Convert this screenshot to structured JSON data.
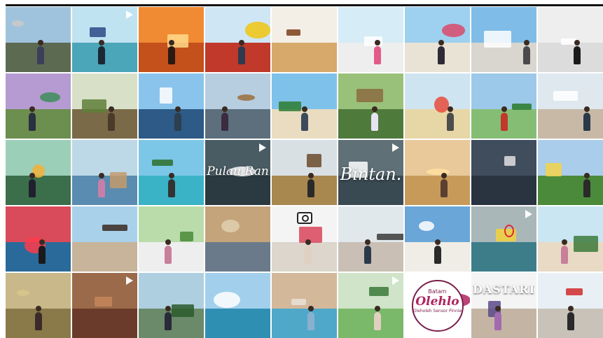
{
  "colors": {
    "background": "#ffffff",
    "frame": "#111111"
  },
  "tiles": [
    {
      "sky": "#9fc3dc",
      "ground": "#5d6a52",
      "accent": "#c9c9c9",
      "person": "#3c3f5a"
    },
    {
      "sky": "#bfe3f1",
      "ground": "#4aa6b8",
      "accent": "#2b4a86",
      "person": "#1c2733"
    },
    {
      "sky": "#f08a33",
      "ground": "#c4501b",
      "accent": "#ffd98a",
      "person": "#2a1a12"
    },
    {
      "sky": "#cfe6f5",
      "ground": "#c0392b",
      "accent": "#f1c40f",
      "person": "#2e3a4d"
    },
    {
      "sky": "#f3efe6",
      "ground": "#d7a96b",
      "accent": "#7a3e1a",
      "person": ""
    },
    {
      "sky": "#d6ecf7",
      "ground": "#eeeeee",
      "accent": "#ffffff",
      "person": "#e25a8a"
    },
    {
      "sky": "#9ed0ef",
      "ground": "#e9e3d6",
      "accent": "#d94a6a",
      "person": "#2f2a38"
    },
    {
      "sky": "#7fbde8",
      "ground": "#d9d6cf",
      "accent": "#ffffff",
      "person": "#4a4a4a"
    },
    {
      "sky": "#eeeeee",
      "ground": "#dcdcdc",
      "accent": "#ffffff",
      "person": "#1a1a1a"
    },
    {
      "sky": "#b59bd1",
      "ground": "#6c8e4f",
      "accent": "#3d8d5a",
      "person": "#293040"
    },
    {
      "sky": "#d8e0c8",
      "ground": "#7a6a48",
      "accent": "#5f7f3a",
      "person": "#4a3a2a"
    },
    {
      "sky": "#8ac4ec",
      "ground": "#2d5a86",
      "accent": "#ffffff",
      "person": "#2c3e50"
    },
    {
      "sky": "#b7cde0",
      "ground": "#5d6f7c",
      "accent": "#9b6e3a",
      "person": "#3b2c3f"
    },
    {
      "sky": "#7ec2ea",
      "ground": "#e9dcc0",
      "accent": "#2e7d32",
      "person": "#3c4a5c"
    },
    {
      "sky": "#9ac179",
      "ground": "#4e7a3c",
      "accent": "#8a6b3f",
      "person": "#e8e3f3"
    },
    {
      "sky": "#cfe4f1",
      "ground": "#e7d7a6",
      "accent": "#e74c3c",
      "person": "#4d4d4d"
    },
    {
      "sky": "#9cc9ea",
      "ground": "#86bd74",
      "accent": "#2a7a2a",
      "person": "#c0392b"
    },
    {
      "sky": "#dfe8ee",
      "ground": "#c7b9a6",
      "accent": "#ffffff",
      "person": "#2b3a4a"
    },
    {
      "sky": "#9ccfb7",
      "ground": "#3b6e4a",
      "accent": "#f3b23a",
      "person": "#1f1f2e"
    },
    {
      "sky": "#bdd9e8",
      "ground": "#5a8bb0",
      "accent": "#c49a6c",
      "person": "#c77fa9"
    },
    {
      "sky": "#7cc7e8",
      "ground": "#3bb3c7",
      "accent": "#2e6e2a",
      "person": "#333333"
    },
    {
      "sky": "#495b63",
      "ground": "#2a3a40",
      "accent": "#ffffff",
      "person": ""
    },
    {
      "sky": "#d9e0e4",
      "ground": "#a8884f",
      "accent": "#6a4a2a",
      "person": "#2a2a2a"
    },
    {
      "sky": "#5f7077",
      "ground": "#3a4a52",
      "accent": "#ffffff",
      "person": ""
    },
    {
      "sky": "#e9c99a",
      "ground": "#c79a5a",
      "accent": "#ffe0a0",
      "person": "#5a4030"
    },
    {
      "sky": "#3f4d5c",
      "ground": "#2a3340",
      "accent": "#e0e0e0",
      "person": ""
    },
    {
      "sky": "#a9cdea",
      "ground": "#4a8a3a",
      "accent": "#f3d24a",
      "person": "#2a2a2a"
    },
    {
      "sky": "#d94a5a",
      "ground": "#2a6a9a",
      "accent": "#ff3a4a",
      "person": "#1a1a1a"
    },
    {
      "sky": "#a9d1ea",
      "ground": "#c7b49a",
      "accent": "#3a2a22",
      "person": ""
    },
    {
      "sky": "#b9dcaa",
      "ground": "#eeeeee",
      "accent": "#4a8a3a",
      "person": "#c77f9a"
    },
    {
      "sky": "#c4a47a",
      "ground": "#6a7a8a",
      "accent": "#e0d0b0",
      "person": ""
    },
    {
      "sky": "#f4f4f4",
      "ground": "#dcd6cc",
      "accent": "#d9445a",
      "person": "#e0d0c0"
    },
    {
      "sky": "#e0e8ec",
      "ground": "#c9bfb4",
      "accent": "#3a3a3a",
      "person": "#2a3a4a"
    },
    {
      "sky": "#6aa6d8",
      "ground": "#f0ece6",
      "accent": "#ffffff",
      "person": "#2a2a2a"
    },
    {
      "sky": "#a9b7b9",
      "ground": "#3d7d8a",
      "accent": "#f3d23a",
      "person": ""
    },
    {
      "sky": "#c9e6f2",
      "ground": "#e8dac4",
      "accent": "#3d7a3a",
      "person": "#c77f9a"
    },
    {
      "sky": "#c9b98a",
      "ground": "#8a7a4a",
      "accent": "#d8c68a",
      "person": "#3a2a2a"
    },
    {
      "sky": "#9a6a4a",
      "ground": "#6a3a2a",
      "accent": "#c4855a",
      "person": ""
    },
    {
      "sky": "#aecfe0",
      "ground": "#6a8a6a",
      "accent": "#2a5a2a",
      "person": "#2a2a3a"
    },
    {
      "sky": "#a2d0ec",
      "ground": "#2f8fb3",
      "accent": "#ffffff",
      "person": ""
    },
    {
      "sky": "#d4b89a",
      "ground": "#4fa8c8",
      "accent": "#e8e0d8",
      "person": "#8ab0d0"
    },
    {
      "sky": "#cfe4c8",
      "ground": "#7ab86a",
      "accent": "#3a7a3a",
      "person": "#e0d0c0"
    },
    {
      "sky": "#ffffff",
      "ground": "#ffffff",
      "accent": "#b0245d",
      "person": ""
    },
    {
      "sky": "#f4f4f4",
      "ground": "#c4b4a4",
      "accent": "#5a4a8a",
      "person": "#a26bb0"
    },
    {
      "sky": "#e8f0f6",
      "ground": "#c9c2b8",
      "accent": "#d12a2a",
      "person": "#2a2a2a"
    }
  ],
  "overlays": {
    "pulau": "Pulau Ran",
    "bintan": "Bintan.",
    "gate": "DASTARI",
    "oleh_top": "Batam",
    "oleh_main": "Olehlo",
    "oleh_sub": "Oleholeh Sensor Pinnie"
  }
}
